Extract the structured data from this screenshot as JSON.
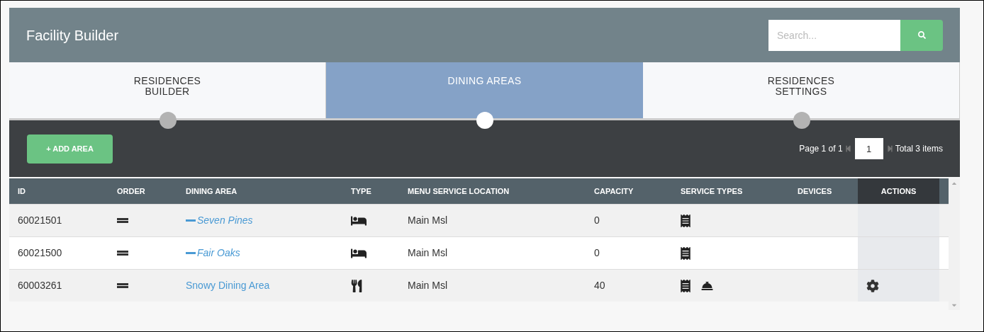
{
  "header": {
    "title": "Facility Builder",
    "search": {
      "placeholder": "Search..."
    }
  },
  "tabs": [
    {
      "label": "RESIDENCES\nBUILDER",
      "selected": false
    },
    {
      "label": "DINING AREAS",
      "selected": true
    },
    {
      "label": "RESIDENCES\nSETTINGS",
      "selected": false
    }
  ],
  "toolbar": {
    "add_button": "+ ADD AREA",
    "pager": {
      "page_text": "Page 1 of 1",
      "page_input": "1",
      "total": "Total 3 items"
    }
  },
  "table": {
    "columns": [
      "ID",
      "ORDER",
      "DINING AREA",
      "TYPE",
      "MENU SERVICE LOCATION",
      "CAPACITY",
      "SERVICE TYPES",
      "DEVICES",
      "ACTIONS"
    ],
    "rows": [
      {
        "id": "60021501",
        "dining_area": "Seven Pines",
        "nested": true,
        "type_icon": {
          "kind": "room"
        },
        "menu_service_location": "Main Msl",
        "capacity": "0",
        "service_types": [
          {
            "kind": "receipt"
          }
        ],
        "settings": false
      },
      {
        "id": "60021500",
        "dining_area": "Fair Oaks",
        "nested": true,
        "type_icon": {
          "kind": "room"
        },
        "menu_service_location": "Main Msl",
        "capacity": "0",
        "service_types": [
          {
            "kind": "receipt"
          }
        ],
        "settings": false
      },
      {
        "id": "60003261",
        "dining_area": "Snowy Dining Area",
        "nested": false,
        "type_icon": {
          "kind": "dining"
        },
        "menu_service_location": "Main Msl",
        "capacity": "40",
        "service_types": [
          {
            "kind": "receipt"
          },
          {
            "kind": "bell"
          }
        ],
        "settings": true
      }
    ]
  }
}
